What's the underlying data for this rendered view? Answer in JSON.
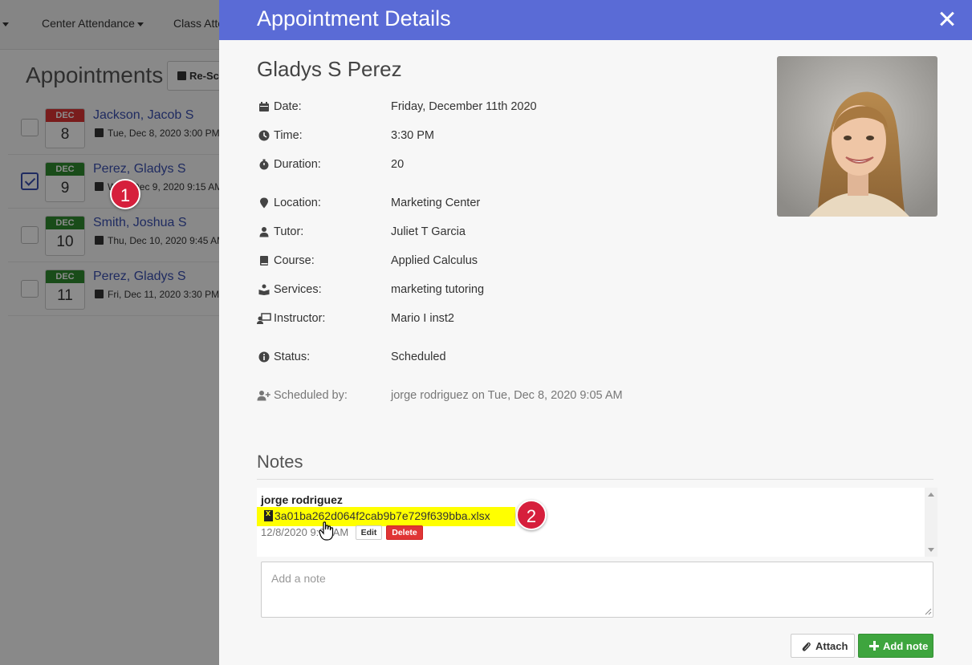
{
  "nav": {
    "item_1": "",
    "item_2": "Center Attendance",
    "item_3": "Class Atte"
  },
  "page": {
    "heading": "Appointments",
    "reschedule_label": "Re-Sc"
  },
  "appointments": [
    {
      "month": "DEC",
      "day": "8",
      "name": "Jackson, Jacob S",
      "when": "Tue, Dec 8, 2020 3:00 PM",
      "checked": false,
      "month_color": "red"
    },
    {
      "month": "DEC",
      "day": "9",
      "name": "Perez, Gladys S",
      "when": "Wed, Dec 9, 2020 9:15 AM",
      "checked": true,
      "month_color": "green"
    },
    {
      "month": "DEC",
      "day": "10",
      "name": "Smith, Joshua S",
      "when": "Thu, Dec 10, 2020 9:45 AM",
      "checked": false,
      "month_color": "green"
    },
    {
      "month": "DEC",
      "day": "11",
      "name": "Perez, Gladys S",
      "when": "Fri, Dec 11, 2020 3:30 PM",
      "checked": false,
      "month_color": "green"
    }
  ],
  "badges": {
    "one": "1",
    "two": "2"
  },
  "modal": {
    "title": "Appointment Details",
    "student_name": "Gladys S Perez",
    "details": [
      {
        "icon": "calendar-icon",
        "label": "Date:",
        "value": "Friday, December 11th 2020"
      },
      {
        "icon": "clock-icon",
        "label": "Time:",
        "value": "3:30 PM"
      },
      {
        "icon": "stopwatch-icon",
        "label": "Duration:",
        "value": "20"
      },
      {
        "icon": "location-pin-icon",
        "label": "Location:",
        "value": "Marketing Center"
      },
      {
        "icon": "tutor-icon",
        "label": "Tutor:",
        "value": "Juliet T Garcia"
      },
      {
        "icon": "book-icon",
        "label": "Course:",
        "value": "Applied Calculus"
      },
      {
        "icon": "services-icon",
        "label": "Services:",
        "value": "marketing tutoring"
      },
      {
        "icon": "instructor-icon",
        "label": "Instructor:",
        "value": "Mario I inst2"
      },
      {
        "icon": "info-icon",
        "label": "Status:",
        "value": "Scheduled"
      },
      {
        "icon": "user-plus-icon",
        "label": "Scheduled by:",
        "value": "jorge rodriguez on Tue, Dec 8, 2020 9:05 AM"
      }
    ],
    "notes": {
      "heading": "Notes",
      "author": "jorge rodriguez",
      "file_name": "3a01ba262d064f2cab9b7e729f639bba.xlsx",
      "date": "12/8/2020 9:05 AM",
      "edit_label": "Edit",
      "delete_label": "Delete",
      "input_placeholder": "Add a note",
      "attach_label": "Attach",
      "add_label": "Add note"
    }
  },
  "colors": {
    "header": "#5a6bd6",
    "highlight": "#ffff00",
    "delete": "#e03535",
    "add": "#3ea53e",
    "link": "#3a4fb0",
    "badge": "#d61f3c"
  }
}
